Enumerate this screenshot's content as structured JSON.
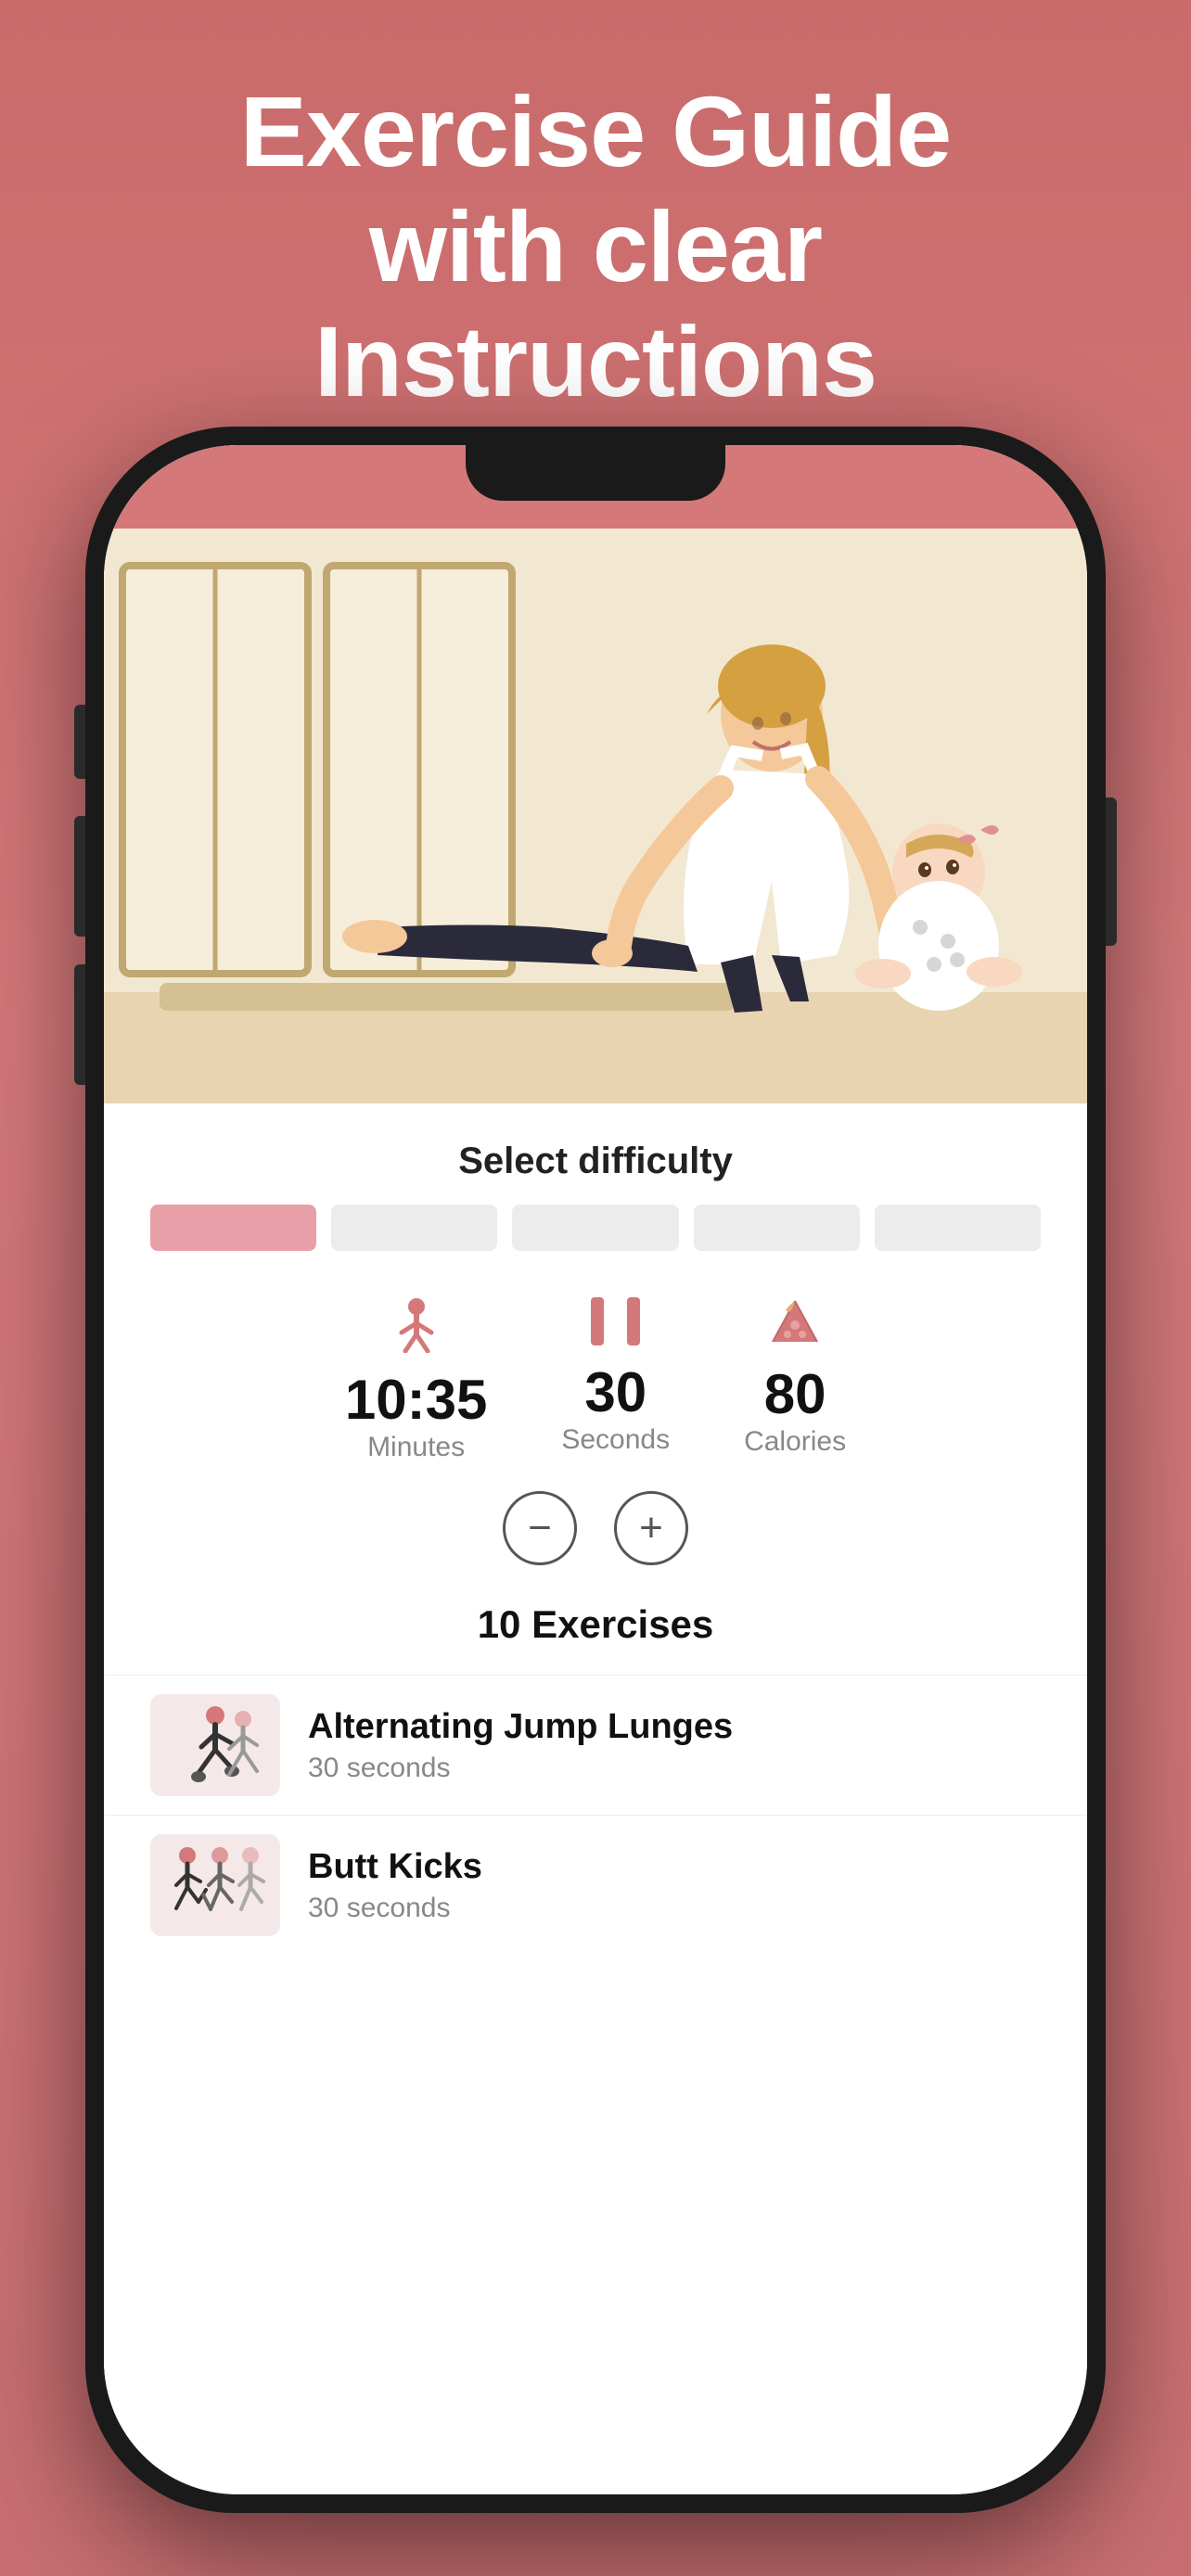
{
  "hero": {
    "title_line1": "Exercise Guide",
    "title_line2": "with clear",
    "title_line3": "Instructions"
  },
  "phone": {
    "screen": {
      "difficulty": {
        "label": "Select difficulty",
        "bars": [
          {
            "active": true
          },
          {
            "active": false
          },
          {
            "active": false
          },
          {
            "active": false
          },
          {
            "active": false
          }
        ]
      },
      "stats": {
        "minutes": {
          "value": "10:35",
          "label": "Minutes"
        },
        "seconds": {
          "value": "30",
          "label": "Seconds"
        },
        "calories": {
          "value": "80",
          "label": "Calories"
        }
      },
      "exercises_header": "10 Exercises",
      "exercises": [
        {
          "name": "Alternating Jump Lunges",
          "duration": "30 seconds"
        },
        {
          "name": "Butt Kicks",
          "duration": "30 seconds"
        }
      ]
    }
  }
}
